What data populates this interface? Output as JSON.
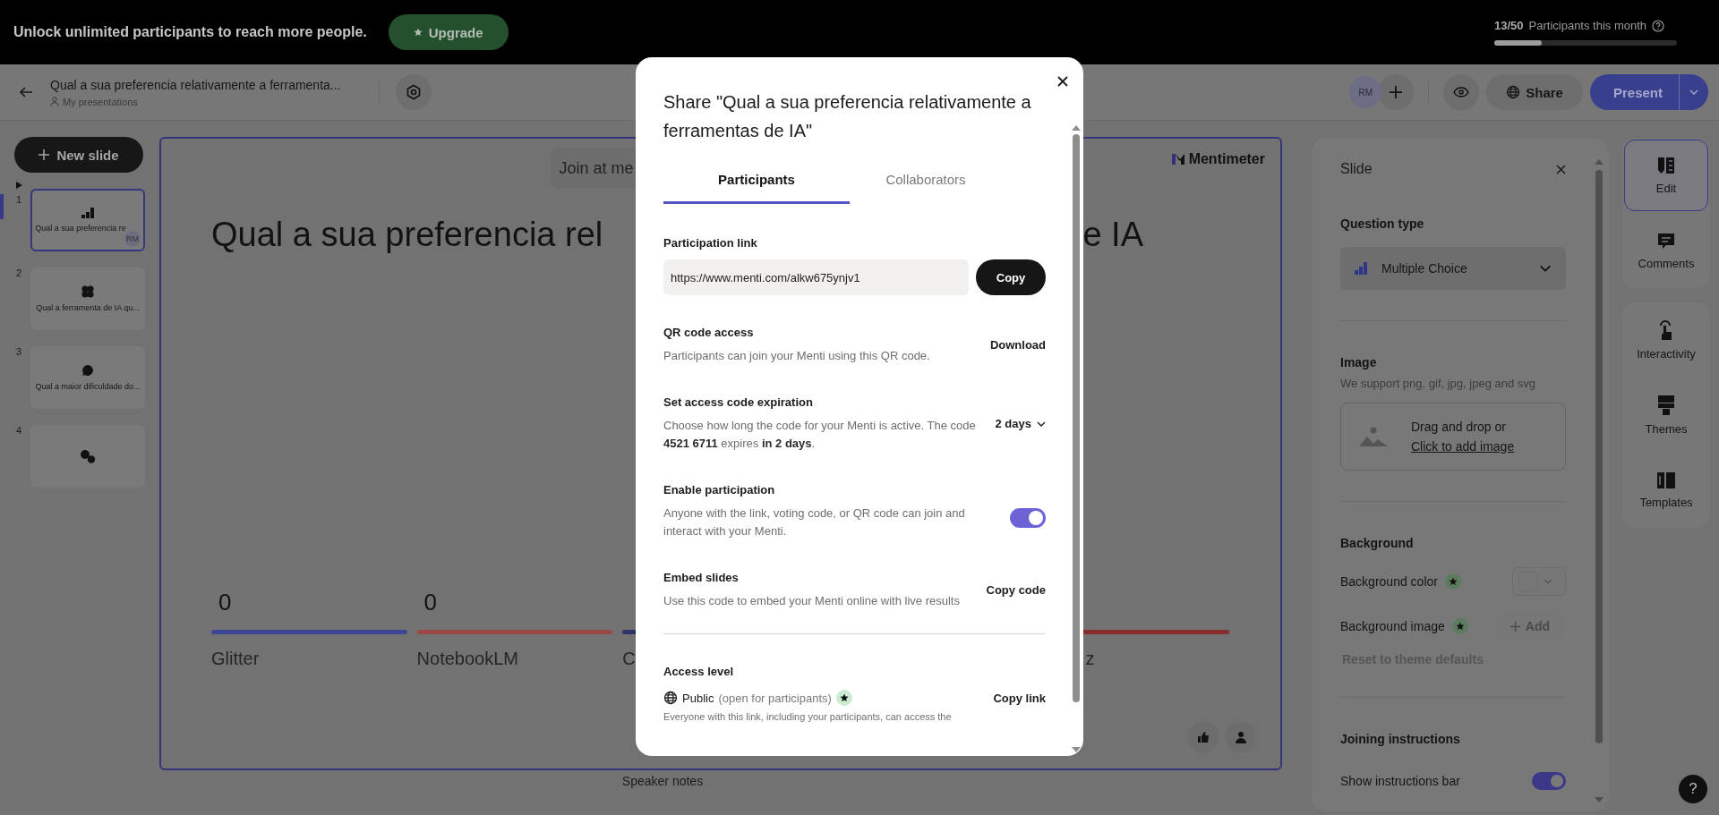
{
  "banner": {
    "message": "Unlock unlimited participants to reach more people.",
    "upgrade_button": "Upgrade",
    "usage": {
      "count": "13/50",
      "label": "Participants this month",
      "level": 0.26
    }
  },
  "header": {
    "title": "Qual a sua preferencia relativamente a ferramenta...",
    "breadcrumb": "My presentations",
    "avatar": "RM",
    "share_button": "Share",
    "present_button": "Present"
  },
  "new_slide_button": "New slide",
  "slides": [
    {
      "number": "1",
      "kind": "bar",
      "caption": "Qual a sua preferencia re",
      "badge": "RM",
      "selected": true
    },
    {
      "number": "2",
      "kind": "wordcloud",
      "caption": "Qual a ferramenta de IA qu...",
      "selected": false
    },
    {
      "number": "3",
      "kind": "open",
      "caption": "Qual a maior dificuldade do...",
      "selected": false
    },
    {
      "number": "4",
      "kind": "qa",
      "selected": false
    }
  ],
  "canvas": {
    "join_text": "Join at me",
    "logo": "Mentimeter",
    "title_start": "Qual a sua preferencia rel",
    "title_end": "e IA",
    "speaker_notes": "Speaker notes",
    "options": [
      {
        "count": "0",
        "label": "Glitter",
        "color": "#3e4597"
      },
      {
        "count": "0",
        "label": "NotebookLM",
        "color": "#9a4845"
      },
      {
        "label": "C",
        "color": "#2f3467"
      },
      {
        "label": "z",
        "color": "#862c2c",
        "covered_start": true
      }
    ]
  },
  "slide_panel": {
    "title": "Slide",
    "question_type_heading": "Question type",
    "question_type": "Multiple Choice",
    "image_heading": "Image",
    "image_hint": "We support png, gif, jpg, jpeg and svg",
    "drop_text": "Drag and drop or",
    "drop_link": "Click to add image",
    "background_heading": "Background",
    "background_color_label": "Background color",
    "background_image_label": "Background image",
    "add_button": "Add",
    "reset_link": "Reset to theme defaults",
    "joining_heading": "Joining instructions",
    "instructions_bar_label": "Show instructions bar",
    "instructions_bar_on": true
  },
  "side_tool_groups": [
    {
      "tools": [
        {
          "kind": "edit",
          "label": "Edit",
          "selected": true
        },
        {
          "kind": "comments",
          "label": "Comments",
          "selected": false
        }
      ]
    },
    {
      "tools": [
        {
          "kind": "interactivity",
          "label": "Interactivity",
          "selected": false
        },
        {
          "kind": "themes",
          "label": "Themes",
          "selected": false
        },
        {
          "kind": "templates",
          "label": "Templates",
          "selected": false
        }
      ]
    }
  ],
  "help_button": "?",
  "share_dialog": {
    "title": "Share \"Qual a sua preferencia relativamente a ferramentas de IA\"",
    "tabs": [
      {
        "label": "Participants",
        "selected": true
      },
      {
        "label": "Collaborators",
        "selected": false
      }
    ],
    "sections": [
      {
        "kind": "link",
        "heading": "Participation link",
        "value": "https://www.menti.com/alkw675ynjv1",
        "action": "Copy"
      },
      {
        "kind": "action",
        "heading": "QR code access",
        "description": "Participants can join your Menti using this QR code.",
        "action": "Download"
      },
      {
        "kind": "select",
        "heading": "Set access code expiration",
        "description": "Choose how long the code for your Menti is active. The code **4521 6711** expires **in 2 days**.",
        "value": "2 days"
      },
      {
        "kind": "toggle",
        "heading": "Enable participation",
        "description": "Anyone with the link, voting code, or QR code can join and interact with your Menti.",
        "on": true
      },
      {
        "kind": "action",
        "heading": "Embed slides",
        "description": "Use this code to embed your Menti online with live results",
        "action": "Copy code"
      },
      {
        "kind": "access",
        "heading": "Access level",
        "level_name": "Public",
        "level_note": "(open for participants)",
        "description": "Everyone with this link, including your participants, can access the",
        "action": "Copy link",
        "divider_before": true
      }
    ]
  }
}
